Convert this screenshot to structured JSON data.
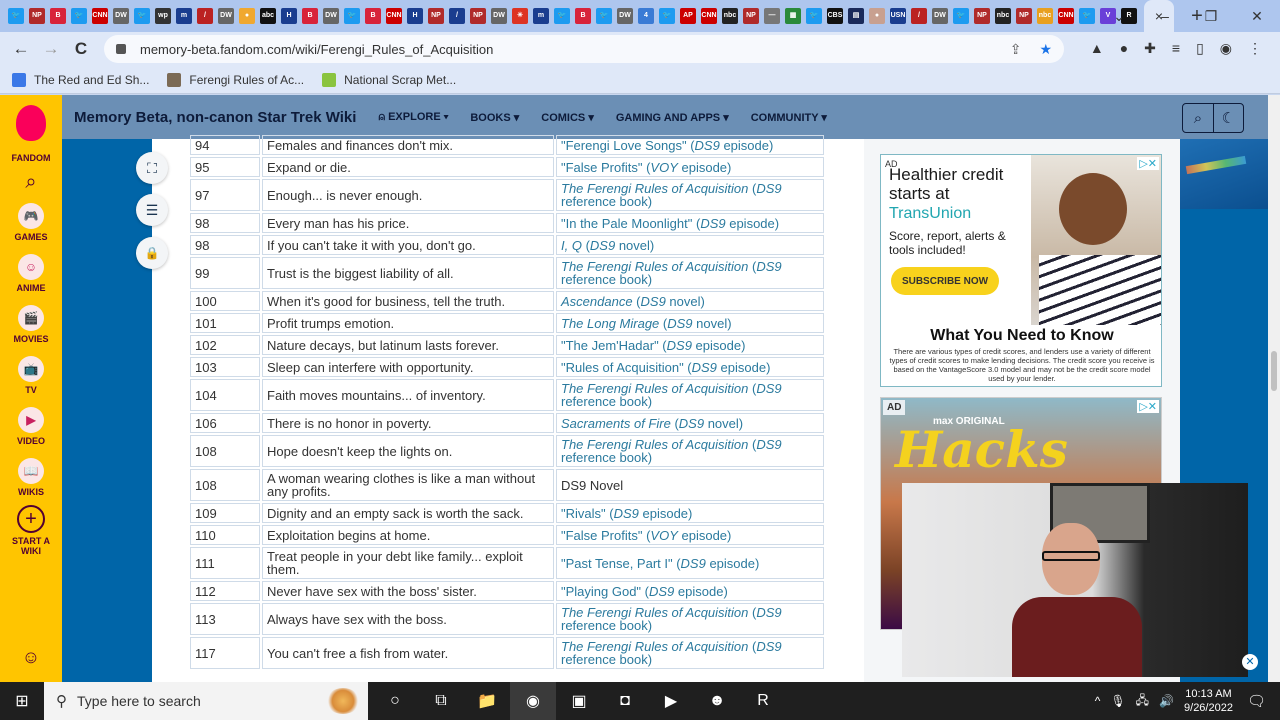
{
  "browser": {
    "active_tab_close": "×",
    "new_tab": "+",
    "window_controls": {
      "tab_search": "⌄",
      "minimize": "–",
      "restore": "❐",
      "close": "✕"
    },
    "url": "memory-beta.fandom.com/wiki/Ferengi_Rules_of_Acquisition",
    "nav": {
      "back": "←",
      "forward": "→",
      "reload": "C"
    },
    "omnibox_icons": {
      "share": "⇪",
      "bookmark": "★"
    },
    "extensions": [
      "▲",
      "●",
      "✚",
      "≡",
      "▯",
      "◉",
      "⋮"
    ],
    "bookmarks": [
      {
        "label": "The Red and Ed Sh...",
        "color": "#3b78e7"
      },
      {
        "label": "Ferengi Rules of Ac...",
        "color": "#7b6a55"
      },
      {
        "label": "National Scrap Met...",
        "color": "#8ac43f"
      }
    ],
    "tab_favicons": [
      {
        "t": "🐦",
        "c": "#1d9bf0"
      },
      {
        "t": "NP",
        "c": "#b02a2a"
      },
      {
        "t": "B",
        "c": "#d8233a"
      },
      {
        "t": "🐦",
        "c": "#1d9bf0"
      },
      {
        "t": "CNN",
        "c": "#cc0000"
      },
      {
        "t": "DW",
        "c": "#666"
      },
      {
        "t": "🐦",
        "c": "#1d9bf0"
      },
      {
        "t": "wp",
        "c": "#333"
      },
      {
        "t": "m",
        "c": "#1a3d8f"
      },
      {
        "t": "/",
        "c": "#b22"
      },
      {
        "t": "DW",
        "c": "#666"
      },
      {
        "t": "●",
        "c": "#f0a830"
      },
      {
        "t": "abc",
        "c": "#111"
      },
      {
        "t": "H",
        "c": "#1a3d8f"
      },
      {
        "t": "B",
        "c": "#d8233a"
      },
      {
        "t": "DW",
        "c": "#666"
      },
      {
        "t": "🐦",
        "c": "#1d9bf0"
      },
      {
        "t": "B",
        "c": "#d8233a"
      },
      {
        "t": "CNN",
        "c": "#cc0000"
      },
      {
        "t": "H",
        "c": "#1a3d8f"
      },
      {
        "t": "NP",
        "c": "#b02a2a"
      },
      {
        "t": "/",
        "c": "#1a3d8f"
      },
      {
        "t": "NP",
        "c": "#b02a2a"
      },
      {
        "t": "DW",
        "c": "#666"
      },
      {
        "t": "✳",
        "c": "#d32"
      },
      {
        "t": "m",
        "c": "#1a3d8f"
      },
      {
        "t": "🐦",
        "c": "#1d9bf0"
      },
      {
        "t": "B",
        "c": "#d8233a"
      },
      {
        "t": "🐦",
        "c": "#1d9bf0"
      },
      {
        "t": "DW",
        "c": "#666"
      },
      {
        "t": "4",
        "c": "#3a7bd5"
      },
      {
        "t": "🐦",
        "c": "#1d9bf0"
      },
      {
        "t": "AP",
        "c": "#c00"
      },
      {
        "t": "CNN",
        "c": "#cc0000"
      },
      {
        "t": "nbc",
        "c": "#222"
      },
      {
        "t": "NP",
        "c": "#b02a2a"
      },
      {
        "t": "—",
        "c": "#777"
      },
      {
        "t": "▦",
        "c": "#2a8a3a"
      },
      {
        "t": "🐦",
        "c": "#1d9bf0"
      },
      {
        "t": "CBS",
        "c": "#111"
      },
      {
        "t": "▤",
        "c": "#1a2a5a"
      },
      {
        "t": "●",
        "c": "#c8a090"
      },
      {
        "t": "USN",
        "c": "#1a3d8f"
      },
      {
        "t": "/",
        "c": "#b22"
      },
      {
        "t": "DW",
        "c": "#666"
      },
      {
        "t": "🐦",
        "c": "#1d9bf0"
      },
      {
        "t": "NP",
        "c": "#b02a2a"
      },
      {
        "t": "nbc",
        "c": "#222"
      },
      {
        "t": "NP",
        "c": "#b02a2a"
      },
      {
        "t": "nbc",
        "c": "#e8a020"
      },
      {
        "t": "CNN",
        "c": "#cc0000"
      },
      {
        "t": "🐦",
        "c": "#1d9bf0"
      },
      {
        "t": "V",
        "c": "#6a3fd8"
      },
      {
        "t": "R",
        "c": "#111"
      }
    ]
  },
  "fandom_rail": {
    "brand": "FANDOM",
    "search_icon": "⌕",
    "items": [
      {
        "label": "GAMES",
        "icon": "🎮"
      },
      {
        "label": "ANIME",
        "icon": "☺"
      },
      {
        "label": "MOVIES",
        "icon": "🎬"
      },
      {
        "label": "TV",
        "icon": "📺"
      },
      {
        "label": "VIDEO",
        "icon": "▶"
      },
      {
        "label": "WIKIS",
        "icon": "📖"
      }
    ],
    "start_wiki": "START A WIKI",
    "start_wiki_icon": "+",
    "user_icon": "☺"
  },
  "wiki": {
    "title": "Memory Beta, non-canon Star Trek Wiki",
    "nav": [
      {
        "label": "EXPLORE",
        "prefix": "⍝ "
      },
      {
        "label": "BOOKS",
        "prefix": ""
      },
      {
        "label": "COMICS",
        "prefix": ""
      },
      {
        "label": "GAMING AND APPS",
        "prefix": ""
      },
      {
        "label": "COMMUNITY",
        "prefix": ""
      }
    ],
    "dropdown_arrow": "▾",
    "tools": {
      "search": "⌕",
      "theme": "☾"
    },
    "floating": {
      "fullscreen": "⛶",
      "toc": "☰",
      "lock": "🔒"
    }
  },
  "rules_table": {
    "rows": [
      {
        "no": "94",
        "rule": "Females and finances don't mix.",
        "src_pre": "\"Ferengi Love Songs\" (",
        "src_it": "DS9",
        "src_post": " episode)",
        "title_italic": false
      },
      {
        "no": "95",
        "rule": "Expand or die.",
        "src_pre": "\"False Profits\" (",
        "src_it": "VOY",
        "src_post": " episode)",
        "title_italic": false
      },
      {
        "no": "97",
        "rule": "Enough... is never enough.",
        "src_pre": "The Ferengi Rules of Acquisition",
        "src_mid": " (",
        "src_it": "DS9",
        "src_post": " reference book)",
        "title_italic": true
      },
      {
        "no": "98",
        "rule": "Every man has his price.",
        "src_pre": "\"In the Pale Moonlight\" (",
        "src_it": "DS9",
        "src_post": " episode)",
        "title_italic": false
      },
      {
        "no": "98",
        "rule": "If you can't take it with you, don't go.",
        "src_pre": "I, Q",
        "src_mid": " (",
        "src_it": "DS9",
        "src_post": " novel)",
        "title_italic": true
      },
      {
        "no": "99",
        "rule": "Trust is the biggest liability of all.",
        "src_pre": "The Ferengi Rules of Acquisition",
        "src_mid": " (",
        "src_it": "DS9",
        "src_post": " reference book)",
        "title_italic": true
      },
      {
        "no": "100",
        "rule": "When it's good for business, tell the truth.",
        "src_pre": "Ascendance",
        "src_mid": " (",
        "src_it": "DS9",
        "src_post": " novel)",
        "title_italic": true
      },
      {
        "no": "101",
        "rule": "Profit trumps emotion.",
        "src_pre": "The Long Mirage",
        "src_mid": " (",
        "src_it": "DS9",
        "src_post": " novel)",
        "title_italic": true
      },
      {
        "no": "102",
        "rule": "Nature decays, but latinum lasts forever.",
        "src_pre": "\"The Jem'Hadar\" (",
        "src_it": "DS9",
        "src_post": " episode)",
        "title_italic": false
      },
      {
        "no": "103",
        "rule": "Sleep can interfere with opportunity.",
        "src_pre": "\"Rules of Acquisition\" (",
        "src_it": "DS9",
        "src_post": " episode)",
        "title_italic": false
      },
      {
        "no": "104",
        "rule": "Faith moves mountains... of inventory.",
        "src_pre": "The Ferengi Rules of Acquisition",
        "src_mid": " (",
        "src_it": "DS9",
        "src_post": " reference book)",
        "title_italic": true
      },
      {
        "no": "106",
        "rule": "There is no honor in poverty.",
        "src_pre": "Sacraments of Fire",
        "src_mid": " (",
        "src_it": "DS9",
        "src_post": " novel)",
        "title_italic": true
      },
      {
        "no": "108",
        "rule": "Hope doesn't keep the lights on.",
        "src_pre": "The Ferengi Rules of Acquisition",
        "src_mid": " (",
        "src_it": "DS9",
        "src_post": " reference book)",
        "title_italic": true
      },
      {
        "no": "108",
        "rule": "A woman wearing clothes is like a man without any profits.",
        "src_plain": "DS9 Novel"
      },
      {
        "no": "109",
        "rule": "Dignity and an empty sack is worth the sack.",
        "src_pre": "\"Rivals\" (",
        "src_it": "DS9",
        "src_post": " episode)",
        "title_italic": false
      },
      {
        "no": "110",
        "rule": "Exploitation begins at home.",
        "src_pre": "\"False Profits\" (",
        "src_it": "VOY",
        "src_post": " episode)",
        "title_italic": false
      },
      {
        "no": "111",
        "rule": "Treat people in your debt like family... exploit them.",
        "src_pre": "\"Past Tense, Part I\" (",
        "src_it": "DS9",
        "src_post": " episode)",
        "title_italic": false
      },
      {
        "no": "112",
        "rule": "Never have sex with the boss' sister.",
        "src_pre": "\"Playing God\" (",
        "src_it": "DS9",
        "src_post": " episode)",
        "title_italic": false
      },
      {
        "no": "113",
        "rule": "Always have sex with the boss.",
        "src_pre": "The Ferengi Rules of Acquisition",
        "src_mid": " (",
        "src_it": "DS9",
        "src_post": " reference book)",
        "title_italic": true
      },
      {
        "no": "117",
        "rule": "You can't free a fish from water.",
        "src_pre": "The Ferengi Rules of Acquisition",
        "src_mid": " (",
        "src_it": "DS9",
        "src_post": " reference book)",
        "title_italic": true
      }
    ]
  },
  "ads": {
    "ad1": {
      "label": "AD",
      "close": "▷✕",
      "headline": "Healthier credit starts at",
      "brand": "TransUnion",
      "subhead": "Score, report, alerts & tools included!",
      "cta": "SUBSCRIBE NOW",
      "title": "What You Need to Know",
      "fine_print": "There are various types of credit scores, and lenders use a variety of different types of credit scores to make lending decisions. The credit score you receive is based on the VantageScore 3.0 model and may not be the credit score model used by your lender."
    },
    "ad2": {
      "label": "AD",
      "close": "▷✕",
      "network": "max ORIGINAL",
      "show": "Hacks"
    }
  },
  "webcam": {
    "close": "✕"
  },
  "taskbar": {
    "start_icon": "⊞",
    "search_placeholder": "Type here to search",
    "search_icon": "⚲",
    "apps": [
      {
        "name": "cortana",
        "icon": "○",
        "active": false
      },
      {
        "name": "task-view",
        "icon": "⧉",
        "active": false
      },
      {
        "name": "file-explorer",
        "icon": "📁",
        "active": false
      },
      {
        "name": "chrome",
        "icon": "◉",
        "active": true
      },
      {
        "name": "monitor-app",
        "icon": "▣",
        "active": false
      },
      {
        "name": "streamlabs",
        "icon": "◘",
        "active": false
      },
      {
        "name": "media-player",
        "icon": "▶",
        "active": false
      },
      {
        "name": "discord",
        "icon": "☻",
        "active": false
      },
      {
        "name": "restream",
        "icon": "R",
        "active": false
      }
    ],
    "tray": {
      "chevron": "^",
      "mic": "🎙",
      "network": "🖧",
      "volume": "🔊"
    },
    "time": "10:13 AM",
    "date": "9/26/2022",
    "notifications": "🗨"
  }
}
